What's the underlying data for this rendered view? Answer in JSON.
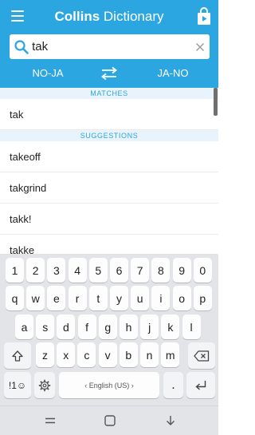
{
  "header": {
    "title_bold": "Collins",
    "title_rest": " Dictionary",
    "menu_icon": "hamburger-menu-icon",
    "store_icon": "store-bag-icon",
    "accent_color": "#2ba6e1"
  },
  "search": {
    "value": "tak",
    "icon": "search-icon",
    "clear_icon": "close-icon"
  },
  "languages": {
    "left": "NO-JA",
    "right": "JA-NO",
    "swap_icon": "swap-arrows-icon"
  },
  "results": {
    "matches_header": "MATCHES",
    "matches": [
      "tak"
    ],
    "suggestions_header": "SUGGESTIONS",
    "suggestions": [
      "takeoff",
      "takgrind",
      "takk!",
      "takke"
    ]
  },
  "keyboard": {
    "numbers": [
      "1",
      "2",
      "3",
      "4",
      "5",
      "6",
      "7",
      "8",
      "9",
      "0"
    ],
    "row1": [
      "q",
      "w",
      "e",
      "r",
      "t",
      "y",
      "u",
      "i",
      "o",
      "p"
    ],
    "row2": [
      "a",
      "s",
      "d",
      "f",
      "g",
      "h",
      "j",
      "k",
      "l"
    ],
    "row3": [
      "z",
      "x",
      "c",
      "v",
      "b",
      "n",
      "m"
    ],
    "symbols_label": "!1☺",
    "space_label": "‹ English (US) ›",
    "period_label": ".",
    "shift_icon": "shift-icon",
    "backspace_icon": "backspace-icon",
    "settings_icon": "gear-icon",
    "enter_icon": "enter-icon"
  },
  "navbar": {
    "recent_icon": "recent-apps-icon",
    "home_icon": "home-icon",
    "back_icon": "back-icon"
  }
}
